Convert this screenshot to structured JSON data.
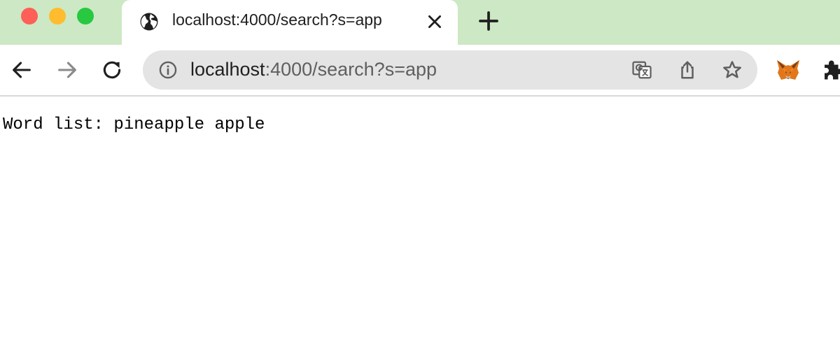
{
  "tab": {
    "title": "localhost:4000/search?s=app",
    "favicon": "globe-icon"
  },
  "omnibox": {
    "host": "localhost",
    "rest": ":4000/search?s=app"
  },
  "page": {
    "text": "Word list: pineapple apple"
  },
  "colors": {
    "tabstrip_bg": "#cde8c4",
    "omnibox_bg": "#e4e4e4",
    "close": "#fe5f57",
    "minimize": "#febc2e",
    "zoom": "#28c840"
  }
}
